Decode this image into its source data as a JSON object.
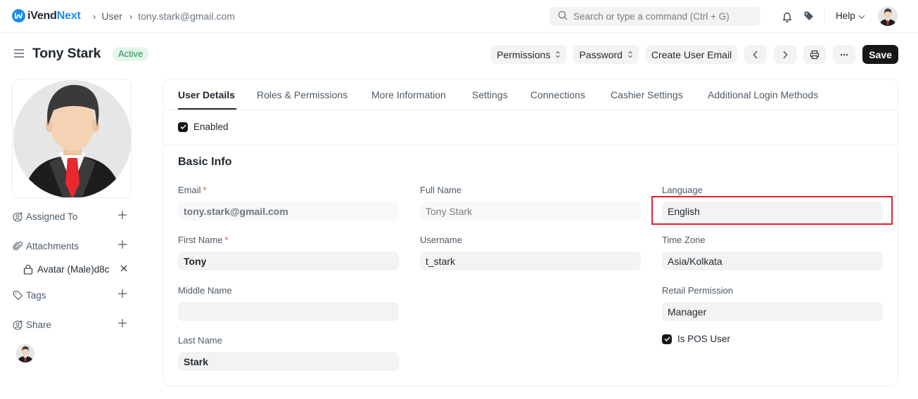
{
  "navbar": {
    "brand_prefix": "iVend",
    "brand_accent": "Next",
    "breadcrumbs": [
      "User",
      "tony.stark@gmail.com"
    ],
    "search_placeholder": "Search or type a command (Ctrl + G)",
    "help_label": "Help",
    "icons": [
      "search-icon",
      "bell-icon",
      "tag-icon",
      "chevron-down-icon",
      "user-avatar"
    ]
  },
  "page": {
    "title": "Tony Stark",
    "status": "Active",
    "actions": {
      "permissions": "Permissions",
      "password": "Password",
      "create_user_email": "Create User Email",
      "save": "Save"
    }
  },
  "sidebar": {
    "assigned_to": "Assigned To",
    "attachments": "Attachments",
    "attachment_file": "Avatar (Male)d8c",
    "tags": "Tags",
    "share": "Share"
  },
  "tabs": [
    {
      "label": "User Details",
      "active": true
    },
    {
      "label": "Roles & Permissions",
      "active": false
    },
    {
      "label": "More Information",
      "active": false
    },
    {
      "label": "Settings",
      "active": false
    },
    {
      "label": "Connections",
      "active": false
    },
    {
      "label": "Cashier Settings",
      "active": false
    },
    {
      "label": "Additional Login Methods",
      "active": false
    }
  ],
  "form": {
    "enabled_label": "Enabled",
    "enabled": true,
    "section_title": "Basic Info",
    "fields": {
      "email": {
        "label": "Email",
        "value": "tony.stark@gmail.com",
        "required": true
      },
      "first_name": {
        "label": "First Name",
        "value": "Tony",
        "required": true
      },
      "middle_name": {
        "label": "Middle Name",
        "value": ""
      },
      "last_name": {
        "label": "Last Name",
        "value": "Stark"
      },
      "full_name": {
        "label": "Full Name",
        "value": "Tony Stark"
      },
      "username": {
        "label": "Username",
        "value": "t_stark"
      },
      "language": {
        "label": "Language",
        "value": "English"
      },
      "time_zone": {
        "label": "Time Zone",
        "value": "Asia/Kolkata"
      },
      "retail_permission": {
        "label": "Retail Permission",
        "value": "Manager"
      }
    },
    "is_pos_user_label": "Is POS User",
    "is_pos_user": true,
    "required_mark": "*"
  },
  "colors": {
    "brand": "#1a8cf0",
    "active_badge_bg": "#e4f5e9",
    "active_badge_text": "#278f5e",
    "primary_button": "#171717",
    "highlight": "#e3212b"
  }
}
